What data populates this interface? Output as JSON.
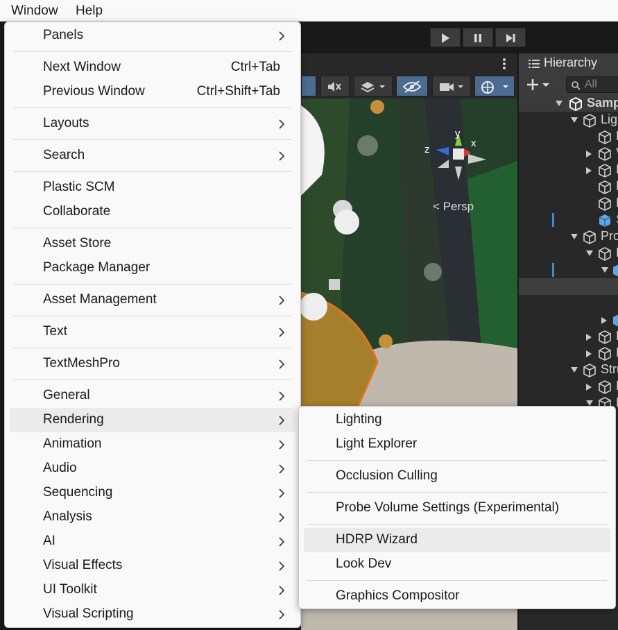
{
  "menubar": {
    "items": [
      "Window",
      "Help"
    ]
  },
  "hierarchy": {
    "title": "Hierarchy",
    "search_placeholder": "All",
    "rows": [
      "Samp",
      "Lig",
      "D",
      "V",
      "F",
      "L",
      "L",
      "S",
      "Pro",
      "F",
      "",
      "",
      "",
      "F",
      "F",
      "Stru",
      "D",
      "F"
    ]
  },
  "scene": {
    "persp_label": "< Persp",
    "gizmo_y": "y",
    "gizmo_z": "z",
    "gizmo_x": "x"
  },
  "window_menu": {
    "items": [
      {
        "label": "Panels",
        "submenu": true
      },
      {
        "label": "Next Window",
        "shortcut": "Ctrl+Tab"
      },
      {
        "label": "Previous Window",
        "shortcut": "Ctrl+Shift+Tab"
      },
      {
        "label": "Layouts",
        "submenu": true
      },
      {
        "label": "Search",
        "submenu": true
      },
      {
        "label": "Plastic SCM"
      },
      {
        "label": "Collaborate"
      },
      {
        "label": "Asset Store"
      },
      {
        "label": "Package Manager"
      },
      {
        "label": "Asset Management",
        "submenu": true
      },
      {
        "label": "Text",
        "submenu": true
      },
      {
        "label": "TextMeshPro",
        "submenu": true
      },
      {
        "label": "General",
        "submenu": true
      },
      {
        "label": "Rendering",
        "submenu": true,
        "highlighted": true
      },
      {
        "label": "Animation",
        "submenu": true
      },
      {
        "label": "Audio",
        "submenu": true
      },
      {
        "label": "Sequencing",
        "submenu": true
      },
      {
        "label": "Analysis",
        "submenu": true
      },
      {
        "label": "AI",
        "submenu": true
      },
      {
        "label": "Visual Effects",
        "submenu": true
      },
      {
        "label": "UI Toolkit",
        "submenu": true
      },
      {
        "label": "Visual Scripting",
        "submenu": true
      }
    ]
  },
  "rendering_submenu": {
    "items": [
      {
        "label": "Lighting"
      },
      {
        "label": "Light Explorer"
      },
      {
        "label": "Occlusion Culling"
      },
      {
        "label": "Probe Volume Settings (Experimental)"
      },
      {
        "label": "HDRP Wizard",
        "highlighted": true
      },
      {
        "label": "Look Dev"
      },
      {
        "label": "Graphics Compositor"
      }
    ]
  },
  "colors": {
    "menu_bg": "#f9f9f9",
    "menu_highlight": "#ebebeb",
    "scene_green": "#1f3d22",
    "active_tool": "#4a6c91"
  }
}
